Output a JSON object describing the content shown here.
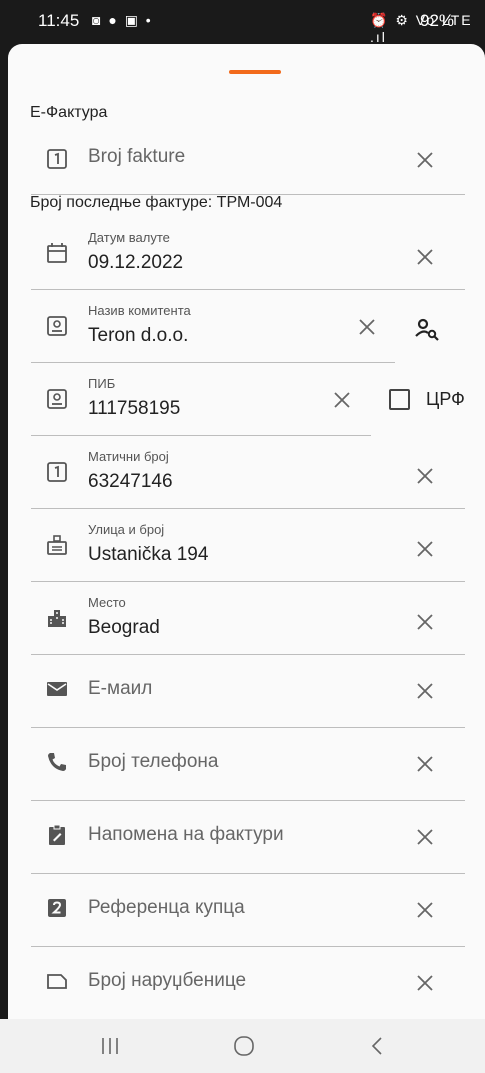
{
  "status": {
    "time": "11:45",
    "left_icons": "◙ ● ▣ •",
    "right_icons": "⏰ ⚙ Vo LTE .ıl",
    "battery": "92%"
  },
  "sheet": {
    "title": "Е-Фактура"
  },
  "fields": {
    "invoice_no": {
      "placeholder": "Broj fakture"
    },
    "last_invoice_hint": "Број последње фактуре: ТРМ-004",
    "currency_date": {
      "label": "Датум валуте",
      "value": "09.12.2022"
    },
    "client_name": {
      "label": "Назив комитента",
      "value": "Teron d.o.o."
    },
    "pib": {
      "label": "ПИБ",
      "value": "111758195"
    },
    "crf": {
      "label": "ЦРФ"
    },
    "reg_no": {
      "label": "Матични број",
      "value": "63247146"
    },
    "street": {
      "label": "Улица и број",
      "value": "Ustanička 194"
    },
    "city": {
      "label": "Место",
      "value": "Beograd"
    },
    "email": {
      "placeholder": "Е-маил"
    },
    "phone": {
      "placeholder": "Број телефона"
    },
    "note": {
      "placeholder": "Напомена на фактури"
    },
    "buyer_ref": {
      "placeholder": "Референца купца"
    },
    "order_no": {
      "placeholder": "Број наруџбенице"
    }
  },
  "colors": {
    "accent": "#f26a1b"
  }
}
